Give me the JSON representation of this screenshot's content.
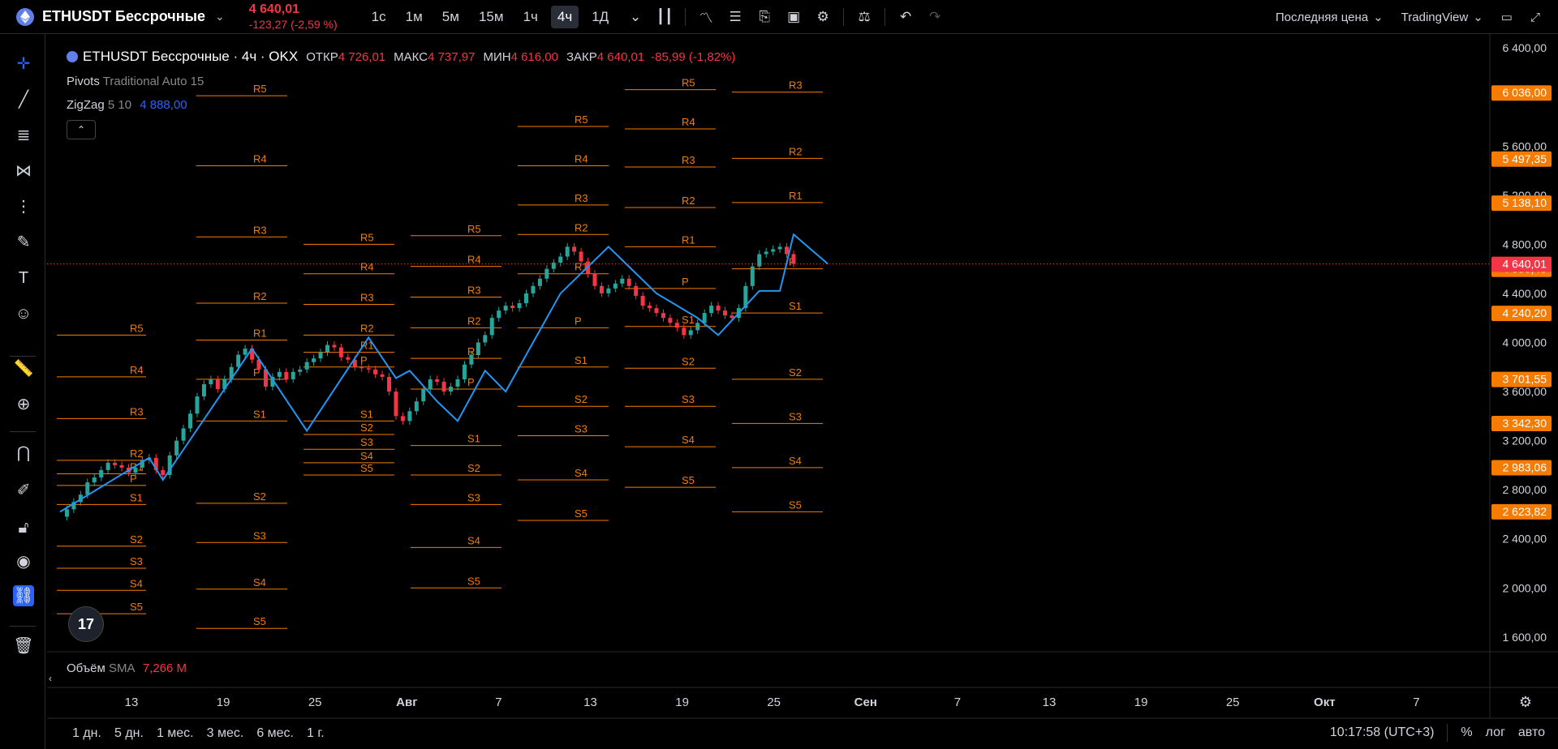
{
  "header": {
    "symbol": "ETHUSDT Бессрочные",
    "price": "4 640,01",
    "change": "-123,27 (-2,59 %)",
    "timeframes": [
      "1с",
      "1м",
      "5м",
      "15м",
      "1ч",
      "4ч",
      "1Д"
    ],
    "active_timeframe": "4ч",
    "price_type": "Последняя цена",
    "broker": "TradingView"
  },
  "legend": {
    "title": "ETHUSDT Бессрочные · 4ч · OKX",
    "open_label": "ОТКР",
    "open": "4 726,01",
    "high_label": "МАКС",
    "high": "4 737,97",
    "low_label": "МИН",
    "low": "4 616,00",
    "close_label": "ЗАКР",
    "close": "4 640,01",
    "change": "-85,99 (-1,82%)"
  },
  "indicators": {
    "pivots_name": "Pivots",
    "pivots_params": "Traditional Auto 15",
    "zigzag_name": "ZigZag",
    "zigzag_params": "5 10",
    "zigzag_value": "4 888,00",
    "volume_name": "Объём",
    "volume_ma": "SMA",
    "volume_value": "7,266 M"
  },
  "time_ranges": [
    "1 дн.",
    "5 дн.",
    "1 мес.",
    "3 мес.",
    "6 мес.",
    "1 г."
  ],
  "status": {
    "clock": "10:17:58 (UTC+3)",
    "percent": "%",
    "log": "лог",
    "auto": "авто"
  },
  "logo_text": "17",
  "colors": {
    "up": "#26a69a",
    "down": "#f23645",
    "pivot": "#f57c00",
    "zigzag": "#2196f3",
    "last_price": "#f23645"
  },
  "chart_data": {
    "type": "candlestick",
    "title": "ETHUSDT Бессрочные · 4ч · OKX",
    "x_ticks": [
      "13",
      "19",
      "25",
      "Авг",
      "7",
      "13",
      "19",
      "25",
      "Сен",
      "7",
      "13",
      "19",
      "25",
      "Окт",
      "7"
    ],
    "y_ticks": [
      1600,
      2000,
      2400,
      2800,
      3200,
      3600,
      4000,
      4400,
      4800,
      5200,
      5600,
      6400
    ],
    "y_tick_labels": [
      "1 600,00",
      "2 000,00",
      "2 400,00",
      "2 800,00",
      "3 200,00",
      "3 600,00",
      "4 000,00",
      "4 400,00",
      "4 800,00",
      "5 200,00",
      "5 600,00",
      "6 400,00"
    ],
    "ylim": [
      1480,
      6500
    ],
    "last_price": {
      "value": 4640.01,
      "label": "4 640,01"
    },
    "price_markers": [
      {
        "value": 6036.0,
        "label": "6 036,00"
      },
      {
        "value": 5497.35,
        "label": "5 497,35"
      },
      {
        "value": 5138.1,
        "label": "5 138,10"
      },
      {
        "value": 4599.45,
        "label": "4 599,45"
      },
      {
        "value": 4240.2,
        "label": "4 240,20"
      },
      {
        "value": 3701.55,
        "label": "3 701,55"
      },
      {
        "value": 3342.3,
        "label": "3 342,30"
      },
      {
        "value": 2983.06,
        "label": "2 983,06"
      },
      {
        "value": 2623.82,
        "label": "2 623,82"
      }
    ],
    "pivot_periods": [
      {
        "levels": [
          [
            "R5",
            4060
          ],
          [
            "R4",
            3720
          ],
          [
            "R3",
            3380
          ],
          [
            "R2",
            3040
          ],
          [
            "R1",
            2930
          ],
          [
            "P",
            2835
          ],
          [
            "S1",
            2680
          ],
          [
            "S2",
            2340
          ],
          [
            "S3",
            2160
          ],
          [
            "S4",
            1980
          ],
          [
            "S5",
            1790
          ]
        ]
      },
      {
        "levels": [
          [
            "R5",
            6010
          ],
          [
            "R4",
            5440
          ],
          [
            "R3",
            4860
          ],
          [
            "R2",
            4320
          ],
          [
            "R1",
            4020
          ],
          [
            "P",
            3700
          ],
          [
            "S1",
            3360
          ],
          [
            "S2",
            2690
          ],
          [
            "S3",
            2370
          ],
          [
            "S4",
            1990
          ],
          [
            "S5",
            1670
          ]
        ]
      },
      {
        "levels": [
          [
            "R5",
            4800
          ],
          [
            "R4",
            4560
          ],
          [
            "R3",
            4310
          ],
          [
            "R2",
            4060
          ],
          [
            "R1",
            3920
          ],
          [
            "P",
            3800
          ],
          [
            "S1",
            3360
          ],
          [
            "S2",
            3250
          ],
          [
            "S3",
            3130
          ],
          [
            "S4",
            3020
          ],
          [
            "S5",
            2920
          ]
        ]
      },
      {
        "levels": [
          [
            "R5",
            4870
          ],
          [
            "R4",
            4620
          ],
          [
            "R3",
            4370
          ],
          [
            "R2",
            4120
          ],
          [
            "R1",
            3870
          ],
          [
            "P",
            3620
          ],
          [
            "S1",
            3160
          ],
          [
            "S2",
            2920
          ],
          [
            "S3",
            2680
          ],
          [
            "S4",
            2330
          ],
          [
            "S5",
            2000
          ]
        ]
      },
      {
        "levels": [
          [
            "R5",
            5760
          ],
          [
            "R4",
            5440
          ],
          [
            "R3",
            5120
          ],
          [
            "R2",
            4880
          ],
          [
            "R1",
            4560
          ],
          [
            "P",
            4120
          ],
          [
            "S1",
            3800
          ],
          [
            "S2",
            3480
          ],
          [
            "S3",
            3240
          ],
          [
            "S4",
            2880
          ],
          [
            "S5",
            2550
          ]
        ]
      },
      {
        "levels": [
          [
            "R5",
            6060
          ],
          [
            "R4",
            5740
          ],
          [
            "R3",
            5430
          ],
          [
            "R2",
            5100
          ],
          [
            "R1",
            4780
          ],
          [
            "P",
            4440
          ],
          [
            "S1",
            4130
          ],
          [
            "S2",
            3790
          ],
          [
            "S3",
            3480
          ],
          [
            "S4",
            3150
          ],
          [
            "S5",
            2820
          ]
        ]
      },
      {
        "levels": [
          [
            "R3",
            6040
          ],
          [
            "R2",
            5500
          ],
          [
            "R1",
            5140
          ],
          [
            "P",
            4600
          ],
          [
            "S1",
            4240
          ],
          [
            "S2",
            3700
          ],
          [
            "S3",
            3340
          ],
          [
            "S4",
            2980
          ],
          [
            "S5",
            2620
          ]
        ]
      }
    ],
    "zigzag_points": [
      [
        2620,
        0
      ],
      [
        3060,
        13
      ],
      [
        2880,
        15
      ],
      [
        3950,
        28
      ],
      [
        3280,
        36
      ],
      [
        4040,
        45
      ],
      [
        3710,
        49
      ],
      [
        3770,
        51
      ],
      [
        3520,
        55
      ],
      [
        3360,
        58
      ],
      [
        3770,
        62
      ],
      [
        3600,
        65
      ],
      [
        4400,
        73
      ],
      [
        4780,
        80
      ],
      [
        4400,
        87
      ],
      [
        4200,
        93
      ],
      [
        4060,
        96
      ],
      [
        4420,
        102
      ],
      [
        4420,
        105
      ],
      [
        4880,
        107
      ],
      [
        4640,
        112
      ]
    ],
    "close_series": [
      2580,
      2640,
      2700,
      2760,
      2860,
      2900,
      2960,
      3020,
      3000,
      2980,
      2940,
      2980,
      3040,
      3060,
      2960,
      2920,
      3080,
      3200,
      3300,
      3420,
      3560,
      3660,
      3700,
      3620,
      3700,
      3800,
      3900,
      3950,
      3860,
      3780,
      3640,
      3720,
      3760,
      3700,
      3760,
      3780,
      3840,
      3870,
      3920,
      3980,
      3960,
      3880,
      3860,
      3800,
      3790,
      3780,
      3740,
      3720,
      3600,
      3400,
      3360,
      3440,
      3520,
      3620,
      3700,
      3680,
      3600,
      3640,
      3700,
      3820,
      3900,
      4000,
      4060,
      4200,
      4260,
      4300,
      4280,
      4320,
      4400,
      4460,
      4520,
      4600,
      4650,
      4700,
      4780,
      4740,
      4660,
      4560,
      4460,
      4400,
      4440,
      4480,
      4520,
      4460,
      4380,
      4300,
      4280,
      4240,
      4200,
      4160,
      4120,
      4060,
      4100,
      4160,
      4240,
      4300,
      4260,
      4220,
      4200,
      4280,
      4460,
      4620,
      4720,
      4740,
      4760,
      4780,
      4720,
      4640
    ]
  }
}
